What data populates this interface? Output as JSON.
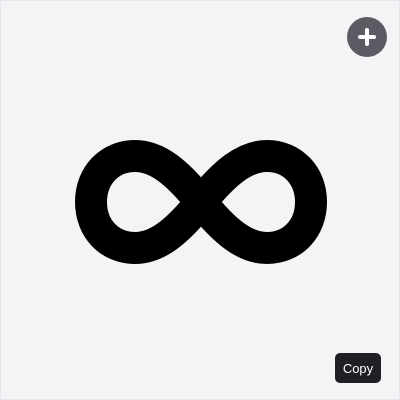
{
  "toolbar": {
    "add_icon": "plus-icon",
    "copy_label": "Copy"
  },
  "symbol": {
    "icon": "infinity-icon",
    "glyph": "∞"
  },
  "colors": {
    "background": "#f4f4f6",
    "add_button": "#5a5b63",
    "symbol": "#000000",
    "copy_button": "#1f1f24",
    "copy_text": "#ffffff"
  }
}
